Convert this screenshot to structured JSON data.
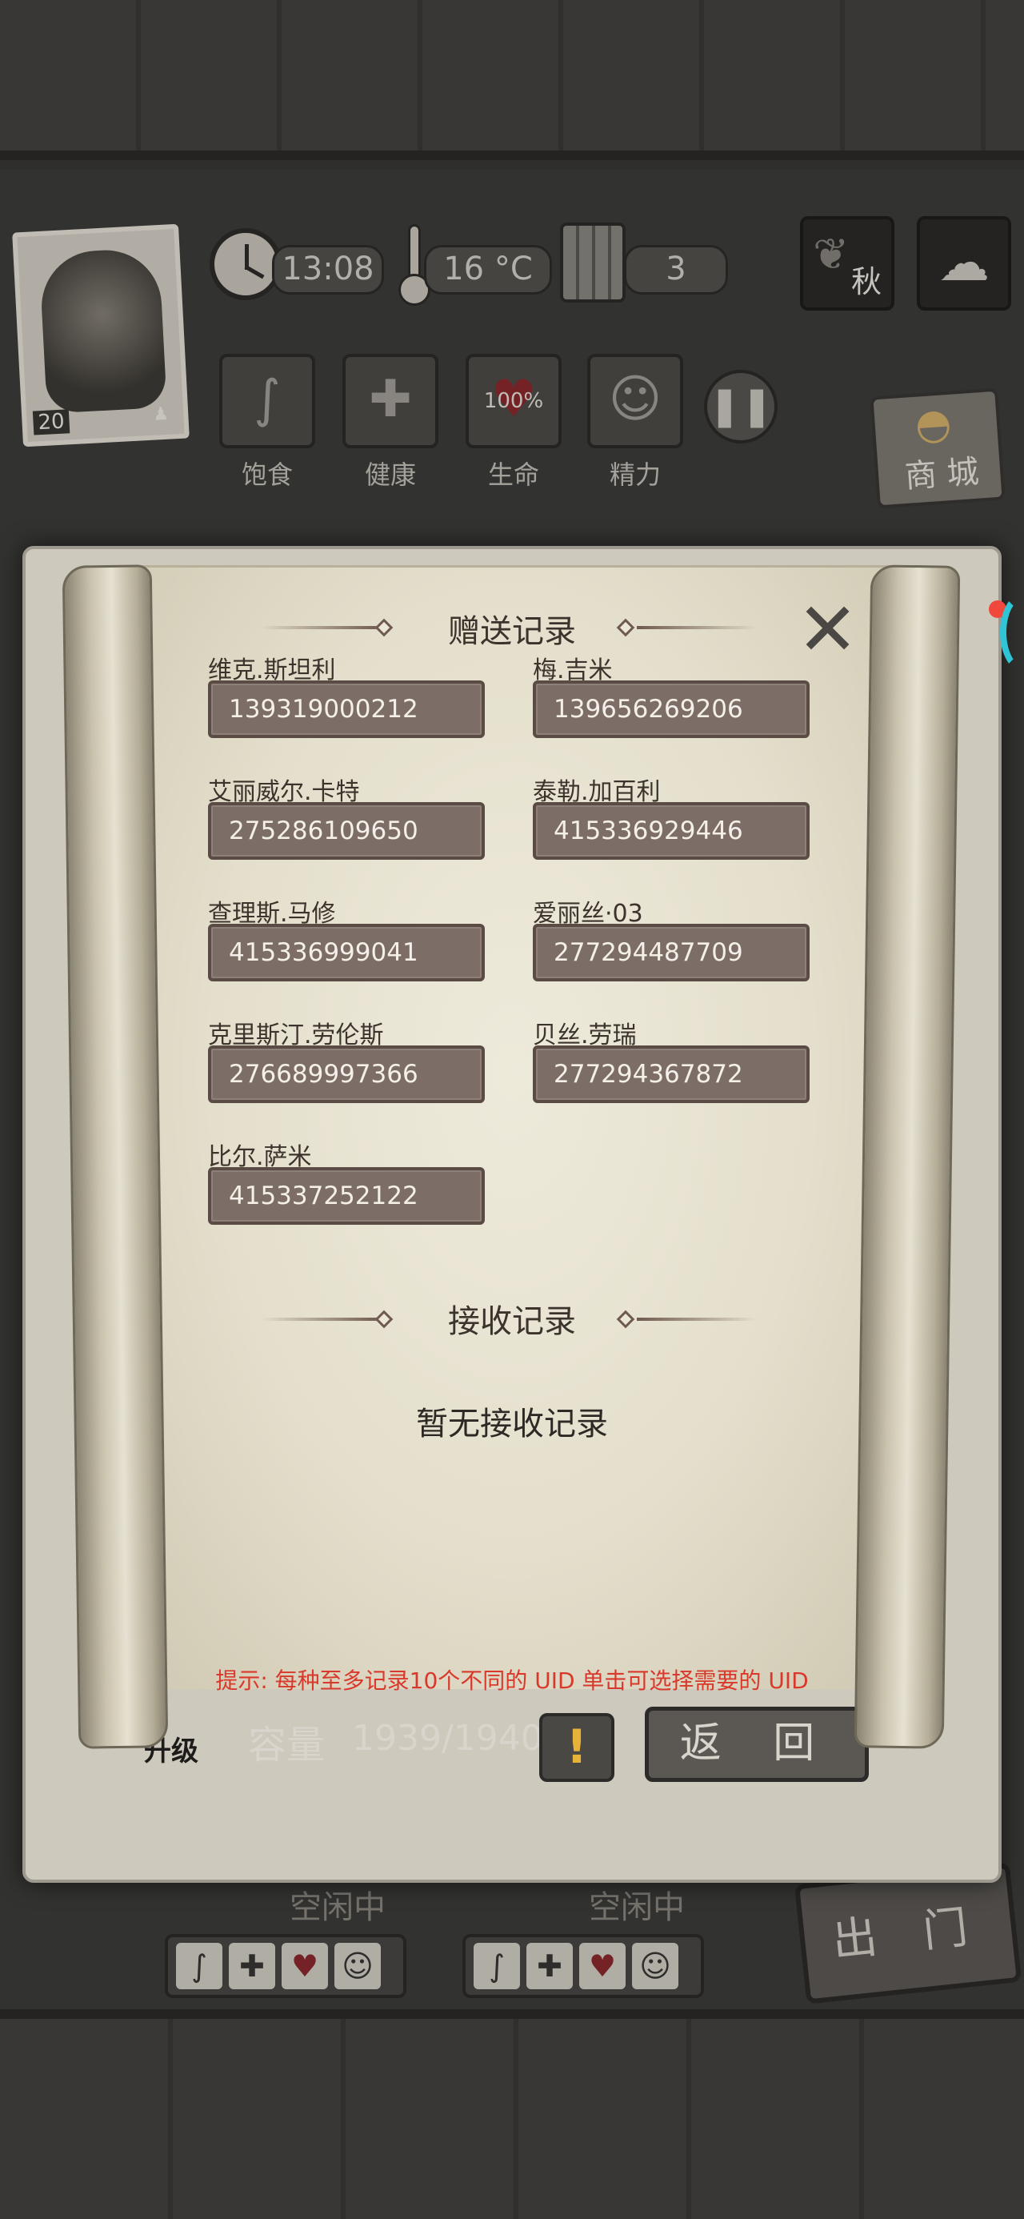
{
  "hud": {
    "level": "20",
    "time": "13:08",
    "temperature": "16 °C",
    "day": "3",
    "season": "秋",
    "stats": [
      {
        "label": "饱食",
        "icon": "stomach-icon",
        "glyph": "∫",
        "value": ""
      },
      {
        "label": "健康",
        "icon": "plus-icon",
        "glyph": "✚",
        "value": ""
      },
      {
        "label": "生命",
        "icon": "heart-icon",
        "glyph": "♥",
        "value": "100%"
      },
      {
        "label": "精力",
        "icon": "person-icon",
        "glyph": "☺",
        "value": ""
      }
    ],
    "pause_glyph": "❚❚",
    "shop_label": "商 城"
  },
  "dialog": {
    "sent_title": "赠送记录",
    "received_title": "接收记录",
    "close_glyph": "✕",
    "sent_records": [
      {
        "name": "维克.斯坦利",
        "uid": "139319000212"
      },
      {
        "name": "梅.吉米",
        "uid": "139656269206"
      },
      {
        "name": "艾丽威尔.卡特",
        "uid": "275286109650"
      },
      {
        "name": "泰勒.加百利",
        "uid": "415336929446"
      },
      {
        "name": "查理斯.马修",
        "uid": "415336999041"
      },
      {
        "name": "爱丽丝·03",
        "uid": "277294487709"
      },
      {
        "name": "克里斯汀.劳伦斯",
        "uid": "276689997366"
      },
      {
        "name": "贝丝.劳瑞",
        "uid": "277294367872"
      },
      {
        "name": "比尔.萨米",
        "uid": "415337252122"
      }
    ],
    "received_empty": "暂无接收记录",
    "hint": "提示: 每种至多记录10个不同的 UID 单击可选择需要的 UID"
  },
  "underbar": {
    "upgrade": "升级",
    "capacity_label": "容量",
    "capacity_value": "1939/1940",
    "alert_glyph": "!",
    "back_label": "返 回"
  },
  "bottom": {
    "idle_left": "空闲中",
    "idle_right": "空闲中",
    "exit_label": "出 门"
  },
  "colors": {
    "hint_red": "#d9392b",
    "uid_box": "#7c6e66",
    "parchment": "#e9e4d3",
    "notification": "#f0483c"
  }
}
